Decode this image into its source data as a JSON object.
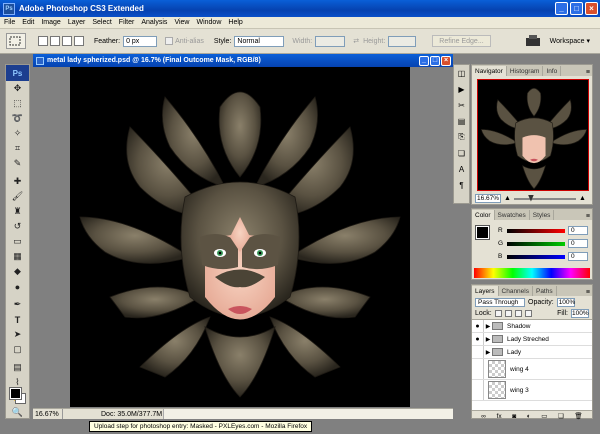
{
  "app": {
    "title": "Adobe Photoshop CS3 Extended",
    "logo": "Ps"
  },
  "menu": [
    "File",
    "Edit",
    "Image",
    "Layer",
    "Select",
    "Filter",
    "Analysis",
    "View",
    "Window",
    "Help"
  ],
  "options": {
    "feather_label": "Feather:",
    "feather_value": "0 px",
    "antialias_label": "Anti-alias",
    "style_label": "Style:",
    "style_value": "Normal",
    "width_label": "Width:",
    "height_label": "Height:",
    "refine_edge_label": "Refine Edge...",
    "workspace_label": "Workspace ▾"
  },
  "document": {
    "title": "metal lady spherized.psd @ 16.7% (Final Outcome Mask, RGB/8)",
    "zoom": "16.67%",
    "doc_info": "Doc: 35.0M/377.7M"
  },
  "navigator": {
    "tabs": [
      "Navigator",
      "Histogram",
      "Info"
    ],
    "zoom": "16.67%"
  },
  "color": {
    "tabs": [
      "Color",
      "Swatches",
      "Styles"
    ],
    "r_label": "R",
    "g_label": "G",
    "b_label": "B",
    "r": "0",
    "g": "0",
    "b": "0"
  },
  "layers": {
    "tabs": [
      "Layers",
      "Channels",
      "Paths"
    ],
    "blend_mode": "Pass Through",
    "opacity_label": "Opacity:",
    "opacity": "100%",
    "lock_label": "Lock:",
    "fill_label": "Fill:",
    "fill": "100%",
    "rows": [
      {
        "name": "Shadow",
        "type": "group"
      },
      {
        "name": "Lady Streched",
        "type": "group"
      },
      {
        "name": "Lady",
        "type": "group"
      },
      {
        "name": "wing 4",
        "type": "layer"
      },
      {
        "name": "wing 3",
        "type": "layer"
      }
    ]
  },
  "tooltip": "Upload step for photoshop entry: Masked - PXLEyes.com - Mozilla Firefox",
  "colors": {
    "title_blue": "#0642b0",
    "canvas_bg": "#000000",
    "chrome": "#e4e1d4"
  }
}
